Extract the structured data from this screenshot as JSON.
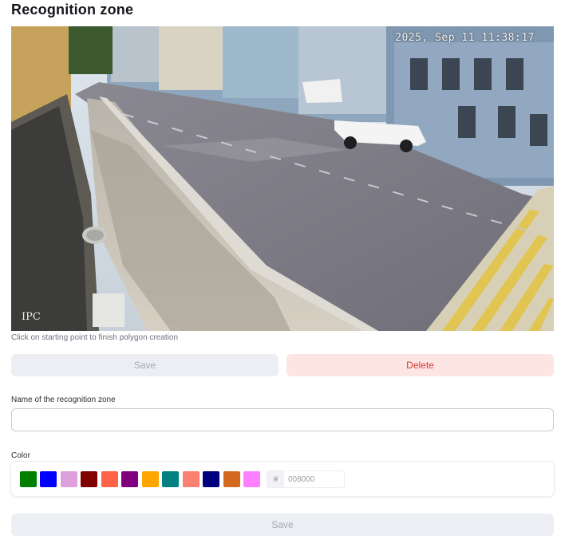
{
  "page": {
    "title": "Recognition zone"
  },
  "camera": {
    "timestamp": "2025, Sep 11 11:38:17",
    "brand": "IPC",
    "hint": "Click on starting point to finish polygon creation"
  },
  "actions": {
    "save_label": "Save",
    "delete_label": "Delete"
  },
  "name_field": {
    "label": "Name of the recognition zone",
    "value": "",
    "placeholder": ""
  },
  "color": {
    "label": "Color",
    "swatches": [
      "#008000",
      "#0000ff",
      "#dda0dd",
      "#800000",
      "#ff6347",
      "#800080",
      "#ffa500",
      "#008080",
      "#fa8072",
      "#000080",
      "#d2691e",
      "#ff80ff"
    ],
    "hex_prefix": "#",
    "hex_value": "008000"
  },
  "footer": {
    "save_label": "Save"
  },
  "icons": {
    "hex": "hash-icon"
  }
}
